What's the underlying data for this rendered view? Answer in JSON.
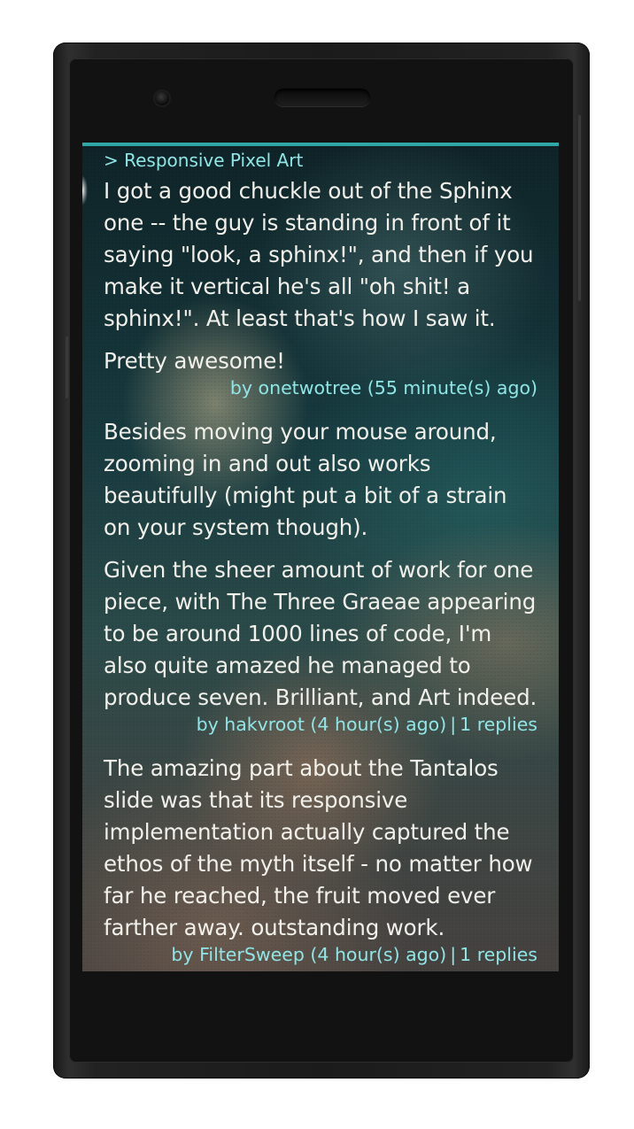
{
  "header": {
    "breadcrumb": "> Responsive Pixel Art"
  },
  "comments": [
    {
      "paragraphs": [
        "I got a good chuckle out of the Sphinx one -- the guy is standing in front of it saying \"look, a sphinx!\", and then if you make it vertical he's all \"oh shit! a sphinx!\". At least that's how I saw it.",
        "Pretty awesome!"
      ],
      "meta": "by onetwotree (55 minute(s) ago)"
    },
    {
      "paragraphs": [
        "Besides moving your mouse around, zooming in and out also works beautifully (might put a bit of a strain on your system though).",
        "Given the sheer amount of work for one piece, with The Three Graeae appearing to be around 1000 lines of code, I'm also quite amazed he managed to produce seven. Brilliant, and Art indeed."
      ],
      "meta_author": "by hakvroot (4 hour(s) ago)",
      "meta_separator": "|",
      "meta_replies": "1 replies"
    },
    {
      "paragraphs": [
        "The amazing part about the Tantalos slide was that its responsive implementation actually captured the ethos of the myth itself - no matter how far he reached, the fruit moved ever farther away. outstanding work."
      ],
      "meta_author": "by FilterSweep (4 hour(s) ago)",
      "meta_separator": "|",
      "meta_replies": "1 replies"
    }
  ],
  "colors": {
    "accent": "#8fe6e6",
    "text": "#f1f0ea",
    "top_bar": "#2fa7a6"
  }
}
